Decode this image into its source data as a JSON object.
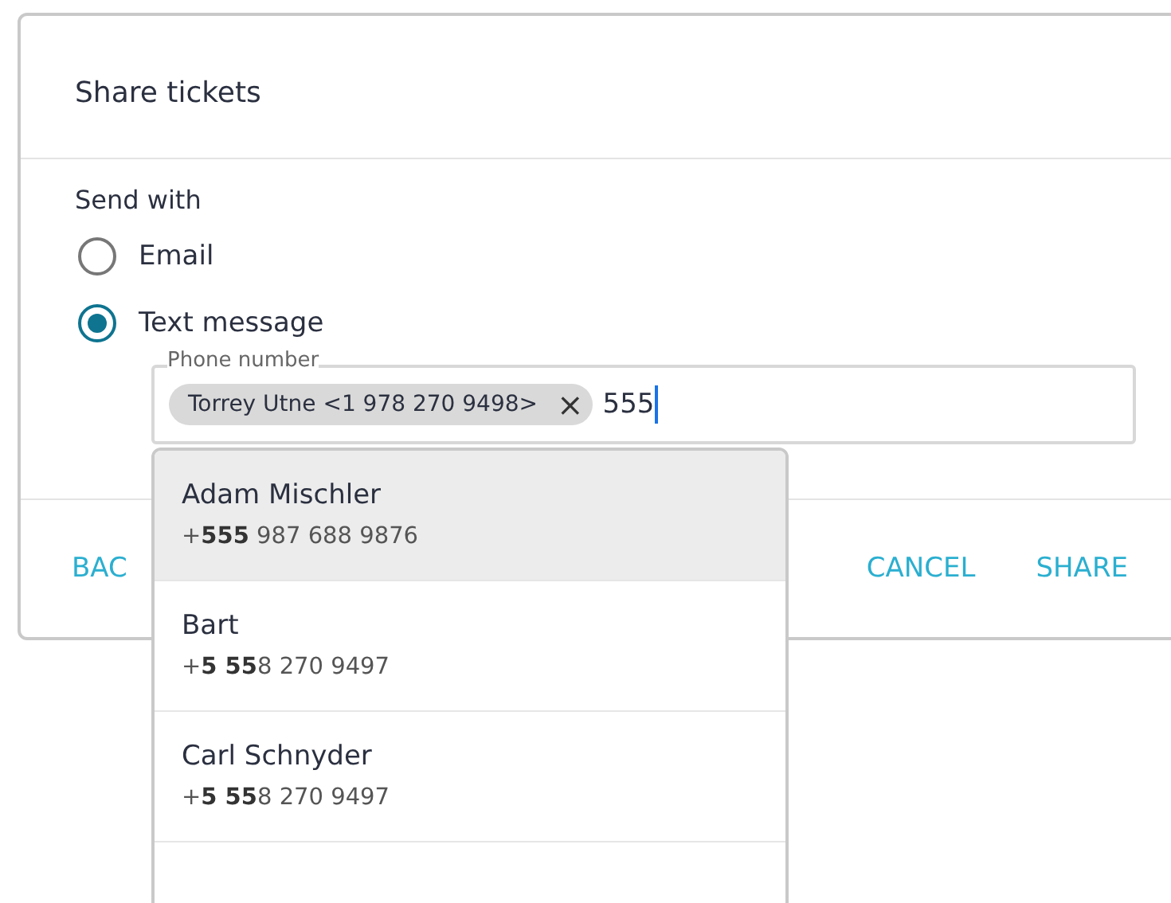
{
  "dialog": {
    "title": "Share tickets"
  },
  "send_with": {
    "label": "Send with",
    "options": [
      {
        "label": "Email",
        "selected": false
      },
      {
        "label": "Text message",
        "selected": true
      }
    ]
  },
  "phone_field": {
    "label": "Phone number",
    "chips": [
      "Torrey Utne <1 978 270 9498>"
    ],
    "chip_remove": "×",
    "value": "555"
  },
  "suggestions": [
    {
      "name": "Adam Mischler",
      "phone": "+**555** 987 688 9876",
      "selected": true
    },
    {
      "name": "Bart",
      "phone": "+**5 55**8 270 9497",
      "selected": false
    },
    {
      "name": "Carl Schnyder",
      "phone": "+**5 55**8 270 9497",
      "selected": false
    }
  ],
  "footer": {
    "back": "BAC",
    "cancel": "CANCEL",
    "share": "SHARE"
  }
}
